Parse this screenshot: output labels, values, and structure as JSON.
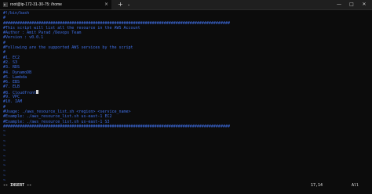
{
  "window": {
    "tab_title": "root@ip-172-31-30-75: /home",
    "new_tab": "+",
    "dropdown": "⌄",
    "minimize": "—",
    "maximize": "□",
    "close": "✕",
    "tab_close": "×"
  },
  "editor": {
    "script_lines": [
      "#!/bin/bash",
      "#",
      "################################################################################################",
      "#This script will list all the resource in the AWS Account",
      "#Author : Amit Parad /Devops Team",
      "#Version : v0.0.1",
      "#",
      "#Following are the supported AWS services by the script",
      "#",
      "#1. EC2",
      "#2. S3",
      "#3. RDS",
      "#4. DynamoDB",
      "#5. Lambda",
      "#6. EBS",
      "#7. ELB",
      "#8. Cloudfront",
      "#9. VPC",
      "#10. IAM",
      "#",
      "#Usage: ./aws_resource_list.sh <region> <service_name>",
      "#Example: ./aws_resource_list.sh us-east-1 EC2",
      "#Example: ./aws_resource_list.sh us-east-1 S3",
      "################################################################################################"
    ],
    "empty_marker": "~"
  },
  "status": {
    "mode": "-- INSERT --",
    "position": "17,14",
    "scroll": "All"
  },
  "colors": {
    "comment": "#3f6fe6",
    "background": "#0c0c0c",
    "foreground": "#e6e6e6"
  }
}
